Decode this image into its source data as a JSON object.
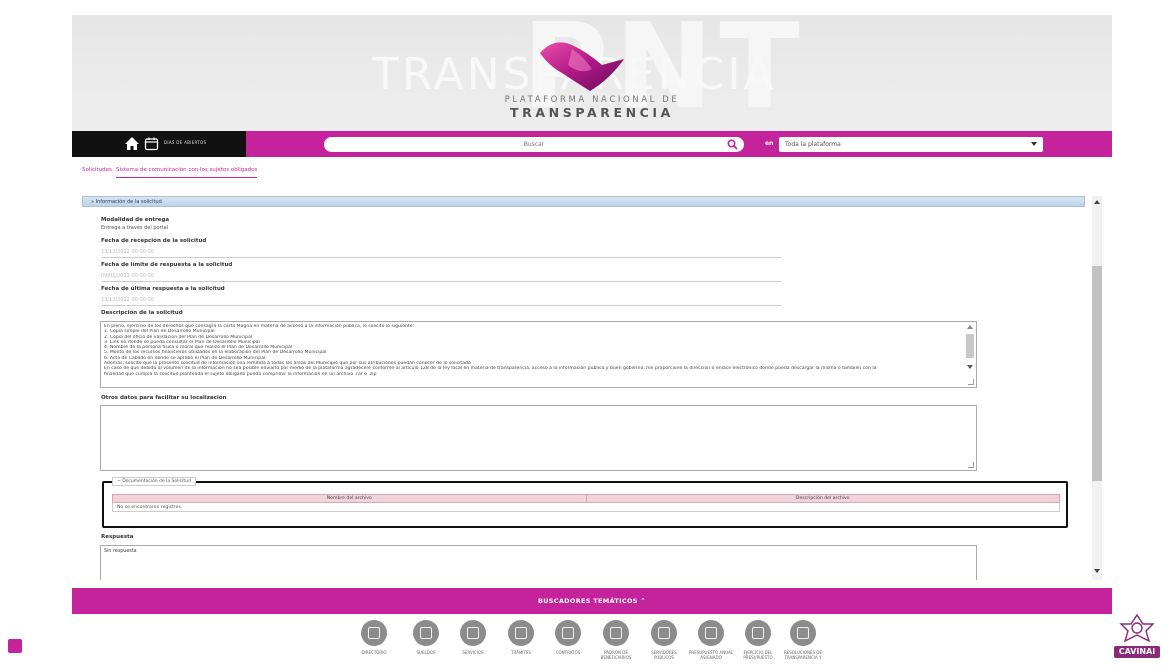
{
  "banner": {
    "platform_line": "PLATAFORMA NACIONAL DE",
    "title": "TRANSPARENCIA",
    "bg_letters": "PNT",
    "bg_word": "TRANSPARENCIA",
    "logo": "pnt-ribbon-logo"
  },
  "navbar": {
    "home_icon": "home-icon",
    "calendar_icon": "calendar-icon",
    "tag": "DIAS DE ABIERTOS",
    "search_placeholder": "Buscar",
    "search_icon": "search-icon",
    "scope_prefix": "en",
    "scope_value": "Toda la plataforma",
    "accent_color": "#c4239c"
  },
  "tabs": [
    {
      "label": "Solicitudes"
    },
    {
      "label": "Sistema de comunicación con los sujetos obligados"
    }
  ],
  "section": {
    "title": "Información de la solicitud",
    "modalidad_label": "Modalidad de entrega",
    "modalidad_value": "Entrega a través del portal",
    "recepcion_label": "Fecha de recepción de la solicitud",
    "recepcion_value": "13/12/2022 00:00:00",
    "limite_label": "Fecha de límite de respuesta a la solicitud",
    "limite_value": "09/01/2023 00:00:00",
    "ultima_label": "Fecha de última respuesta a la solicitud",
    "ultima_value": "13/12/2022 00:00:00",
    "descripcion_label": "Descripción de la solicitud",
    "descripcion_lines": [
      "En pleno, ejercicio de los derechos que consagra la carta Magna en materia de acceso a la información pública, le solicito lo siguiente:",
      "1.     Copia simple del Plan de Desarrollo Municipal",
      "2.     Copia del oficio de validación del Plan de Desarrollo Municipal",
      "3.     Link en donde se pueda consultar el Plan de Desarrollo Municipal",
      "4.     Nombre de la persona física o moral que realizó el Plan de Desarrollo Municipal",
      "5.     Monto de los recursos financieros utilizados en la elaboración del Plan de Desarrollo Municipal",
      "6.     Acta de Cabildo en donde se aprobó el Plan de Desarrollo Municipal",
      "Además, solicito que la presente solicitud de información sea remitida a todas las áreas del Municipio que por sus atribuciones puedan conocer de lo solicitado",
      "En caso de que debido al volumen de la información no sea posible enviarlo por medio de la plataforma agradeceré conforme al artículo 128 de la ley local en materia de transparencia, acceso a la información publica y buen gobierno, me proporcione la dirección o enlace electrónico donde pueda descargar la misma o también con la",
      "finalidad que cumpla la solicitud planteada el sujeto obligado pueda comprimir la información en un archivo .rar o .zip"
    ],
    "otros_label": "Otros datos para facilitar su localización",
    "doc_legend": "Documentación de la Solicitud",
    "doc_headers": [
      "Nombre del archivo",
      "Descripción del archivo"
    ],
    "doc_empty": "No se encontraron registros.",
    "respuesta_label": "Respuesta",
    "respuesta_value": "Sin respuesta"
  },
  "footer": {
    "bar_label": "BUSCADORES TEMÁTICOS",
    "tools": [
      {
        "label": "DIRECTORIO",
        "icon": "directory-icon"
      },
      {
        "label": "SUELDOS",
        "icon": "salary-icon"
      },
      {
        "label": "SERVICIOS",
        "icon": "services-icon"
      },
      {
        "label": "TRÁMITES",
        "icon": "procedures-icon"
      },
      {
        "label": "CONTRATOS",
        "icon": "contracts-icon"
      },
      {
        "label": "PADRÓN DE BENEFICIARIOS",
        "icon": "beneficiaries-icon"
      },
      {
        "label": "SERVIDORES PÚBLICOS",
        "icon": "public-servants-icon"
      },
      {
        "label": "PRESUPUESTO ANUAL ASIGNADO",
        "icon": "budget-icon"
      },
      {
        "label": "EJERCICIO DEL PRESUPUESTO",
        "icon": "budget-exercise-icon"
      },
      {
        "label": "RESOLUCIONES DE TRANSPARENCIA Y",
        "icon": "resolutions-icon"
      }
    ]
  },
  "cavinai": {
    "label": "CAVINAI"
  }
}
